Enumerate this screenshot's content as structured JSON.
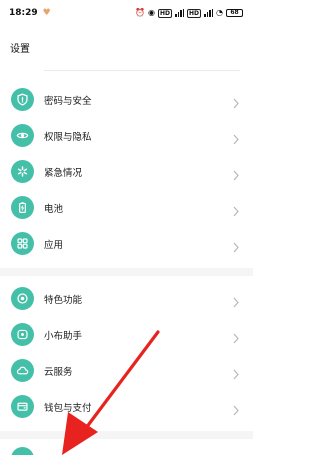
{
  "status_bar": {
    "time": "18:29",
    "battery": "68"
  },
  "header": {
    "title": "设置"
  },
  "menu": {
    "items": [
      {
        "label": "密码与安全",
        "icon": "shield-icon"
      },
      {
        "label": "权限与隐私",
        "icon": "eye-icon"
      },
      {
        "label": "紧急情况",
        "icon": "sos-asterisk-icon"
      },
      {
        "label": "电池",
        "icon": "battery-icon"
      },
      {
        "label": "应用",
        "icon": "apps-grid-icon"
      },
      {
        "label": "特色功能",
        "icon": "target-icon"
      },
      {
        "label": "小布助手",
        "icon": "assistant-icon"
      },
      {
        "label": "云服务",
        "icon": "cloud-icon"
      },
      {
        "label": "钱包与支付",
        "icon": "wallet-icon"
      }
    ]
  },
  "colors": {
    "icon_bg": "#44bfa8",
    "annotation_arrow": "#e8231f"
  }
}
